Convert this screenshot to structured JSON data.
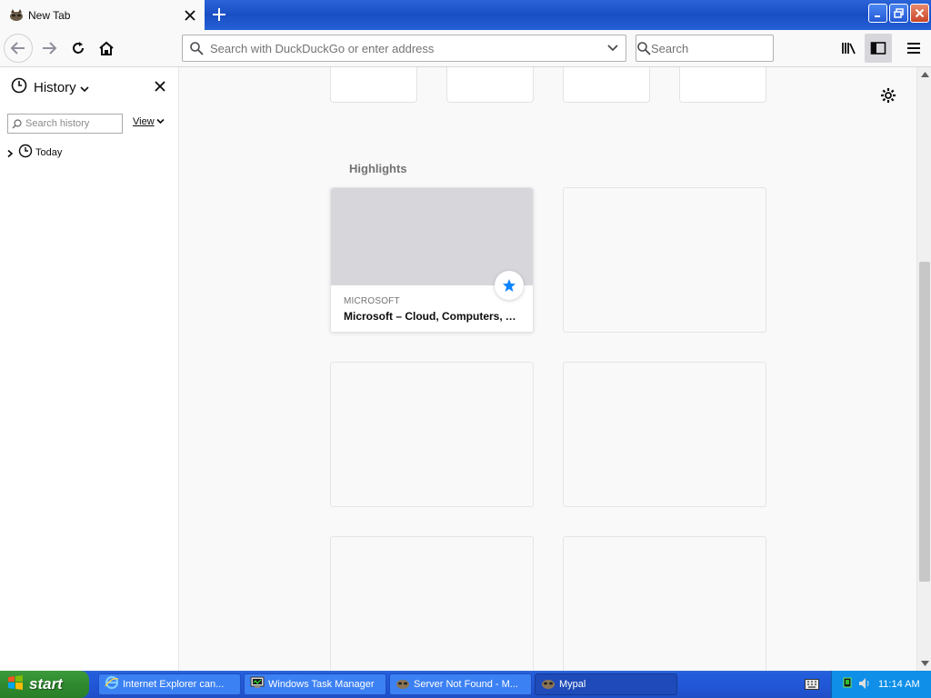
{
  "browser": {
    "tab": {
      "title": "New Tab",
      "favicon": "mypal-raccoon-icon"
    },
    "navbar": {
      "url_placeholder": "Search with DuckDuckGo or enter address",
      "search_placeholder": "Search"
    }
  },
  "sidebar": {
    "title": "History",
    "search_placeholder": "Search history",
    "view_label": "View",
    "tree": [
      {
        "label": "Today"
      }
    ]
  },
  "content": {
    "highlights_title": "Highlights",
    "highlight_card": {
      "host": "MICROSOFT",
      "title": "Microsoft – Cloud, Computers, A..."
    }
  },
  "taskbar": {
    "start_label": "start",
    "tasks": [
      {
        "label": "Internet Explorer can..."
      },
      {
        "label": "Windows Task Manager"
      },
      {
        "label": "Server Not Found - M..."
      },
      {
        "label": "Mypal"
      }
    ],
    "clock": "11:14 AM"
  },
  "colors": {
    "accent_blue": "#0a84ff",
    "xp_taskbar": "#245edb",
    "xp_start_green": "#3c9a3c"
  }
}
